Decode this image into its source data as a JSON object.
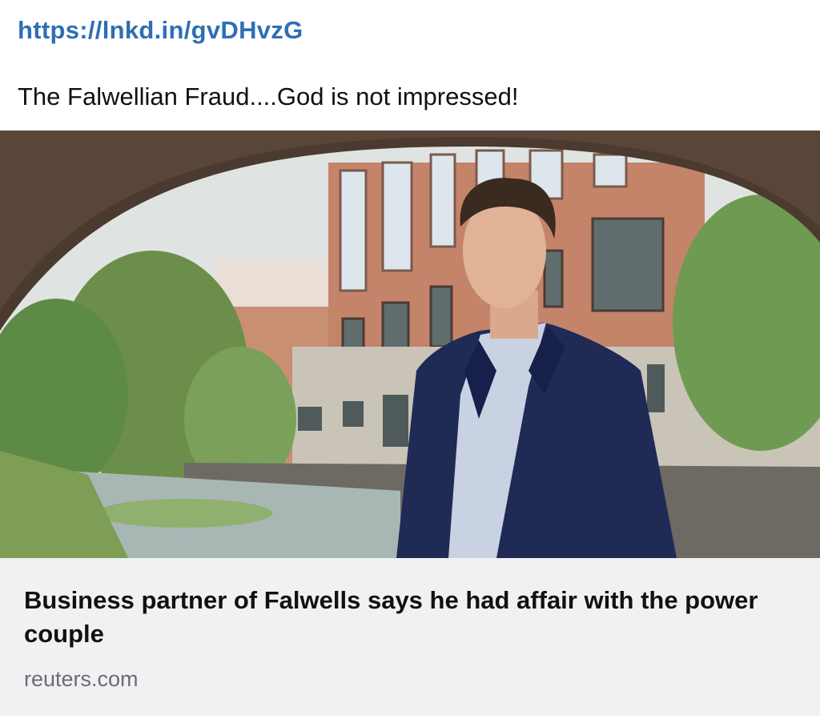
{
  "post": {
    "link_text": "https://lnkd.in/gvDHvzG",
    "text": "The Falwellian Fraud....God is not impressed!"
  },
  "link_card": {
    "image_alt": "Man in navy blazer standing under a stone bridge beside a canal with brick buildings",
    "headline": "Business partner of Falwells says he had affair with the power couple",
    "domain": "reuters.com"
  },
  "colors": {
    "link": "#2f6eb3",
    "card_background": "#f0f1f3",
    "domain_text": "#6b6d71"
  }
}
